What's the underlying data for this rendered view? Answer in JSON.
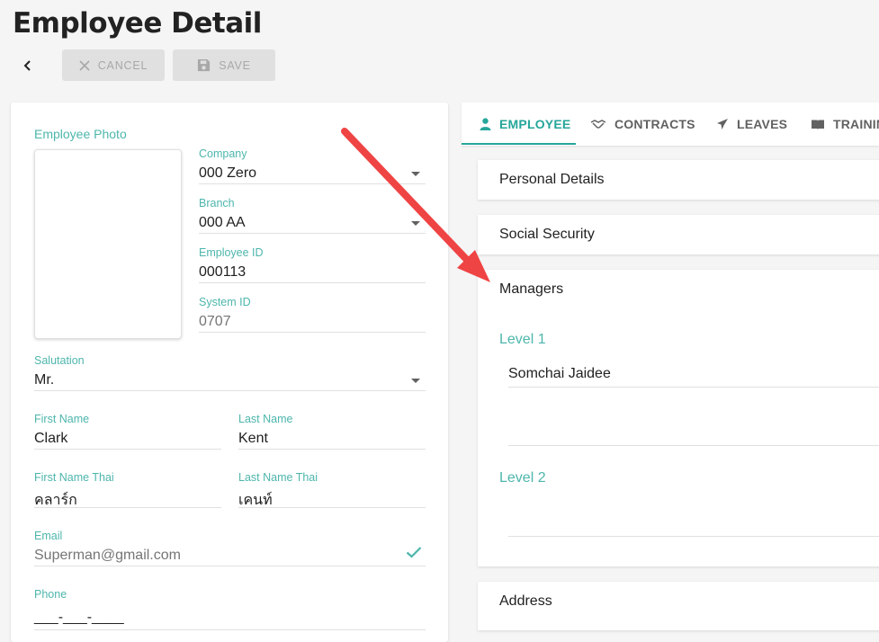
{
  "page": {
    "title": "Employee Detail"
  },
  "toolbar": {
    "cancel_label": "CANCEL",
    "save_label": "SAVE"
  },
  "colors": {
    "accent": "#4db6ac",
    "tab_active": "#26a69a",
    "annotation_arrow": "#ef4444"
  },
  "form": {
    "photo_label": "Employee Photo",
    "company": {
      "label": "Company",
      "value": "000 Zero"
    },
    "branch": {
      "label": "Branch",
      "value": "000 AA"
    },
    "employee_id": {
      "label": "Employee ID",
      "value": "000113"
    },
    "system_id": {
      "label": "System ID",
      "value": "0707"
    },
    "salutation": {
      "label": "Salutation",
      "value": "Mr."
    },
    "first_name": {
      "label": "First Name",
      "value": "Clark"
    },
    "last_name": {
      "label": "Last Name",
      "value": "Kent"
    },
    "first_name_thai": {
      "label": "First Name Thai",
      "value": "คลาร์ก"
    },
    "last_name_thai": {
      "label": "Last Name Thai",
      "value": "เคนท์"
    },
    "email": {
      "label": "Email",
      "value": "Superman@gmail.com"
    },
    "phone": {
      "label": "Phone",
      "value": "___-___-____"
    }
  },
  "tabs": [
    {
      "label": "EMPLOYEE",
      "icon": "person-icon",
      "active": true
    },
    {
      "label": "CONTRACTS",
      "icon": "handshake-icon",
      "active": false
    },
    {
      "label": "LEAVES",
      "icon": "airplane-icon",
      "active": false
    },
    {
      "label": "TRAININ",
      "icon": "book-icon",
      "active": false
    }
  ],
  "sections": {
    "personal_details": "Personal Details",
    "social_security": "Social Security",
    "managers": {
      "title": "Managers",
      "level1_label": "Level 1",
      "level1_value": "Somchai Jaidee",
      "level2_label": "Level 2",
      "level2_value": ""
    },
    "address": "Address"
  }
}
